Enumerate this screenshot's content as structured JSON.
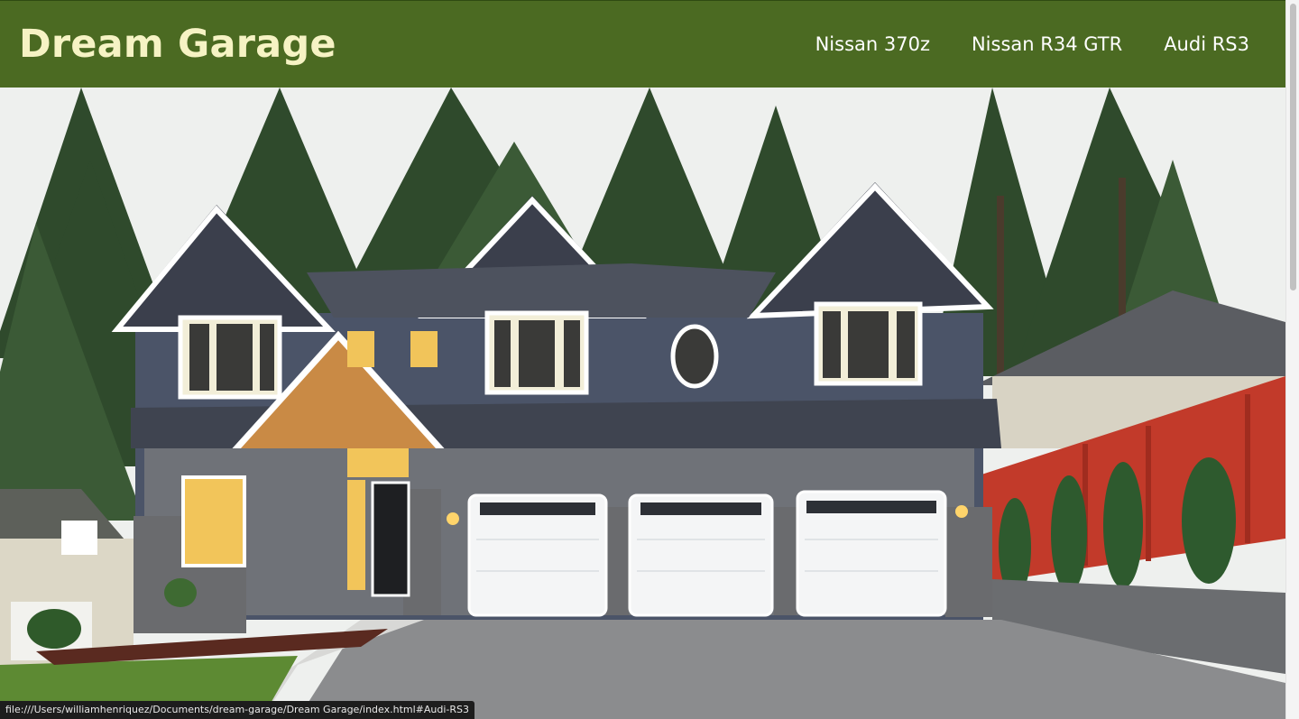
{
  "header": {
    "brand": "Dream Garage",
    "nav": [
      {
        "label": "Nissan 370z"
      },
      {
        "label": "Nissan R34 GTR"
      },
      {
        "label": "Audi RS3"
      }
    ]
  },
  "colors": {
    "header_bg": "#4b6a22",
    "brand_text": "#f6f3c4",
    "nav_text": "#ffffff"
  },
  "hero": {
    "image_subject": "house-with-three-car-garage"
  },
  "status_bar": {
    "url": "file:///Users/williamhenriquez/Documents/dream-garage/Dream Garage/index.html#Audi-RS3"
  }
}
